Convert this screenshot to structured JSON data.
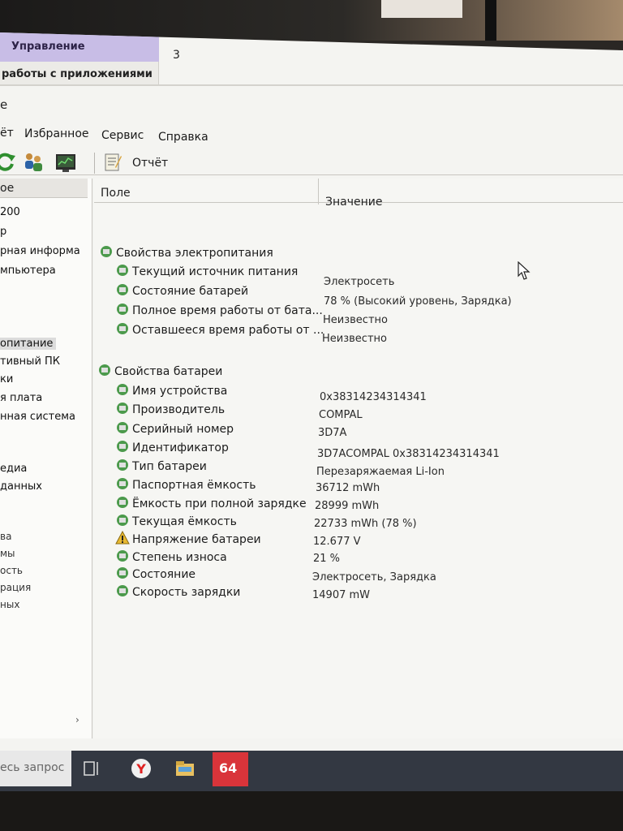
{
  "ribbon": {
    "tab_label": "Управление",
    "number": "3",
    "subtitle": "работы с приложениями"
  },
  "window": {
    "title_fragment": "е"
  },
  "menu": {
    "items": [
      "ёт",
      "Избранное",
      "Сервис",
      "Справка"
    ]
  },
  "toolbar": {
    "report_label": "Отчёт",
    "icons": [
      "refresh-icon",
      "users-icon",
      "monitor-icon",
      "report-icon"
    ]
  },
  "tree": {
    "header": "ое",
    "items": [
      {
        "label": "200"
      },
      {
        "label": "р"
      },
      {
        "label": "рная информа"
      },
      {
        "label": "мпьютера"
      },
      {
        "label": "опитание"
      },
      {
        "label": "тивный ПК"
      },
      {
        "label": "ки"
      },
      {
        "label": "я плата"
      },
      {
        "label": "нная система"
      },
      {
        "label": "едиа"
      },
      {
        "label": "данных"
      },
      {
        "label": "ва"
      },
      {
        "label": "мы"
      },
      {
        "label": "ость"
      },
      {
        "label": "рация"
      },
      {
        "label": "ных"
      }
    ],
    "selected_index": 4
  },
  "table": {
    "col_field": "Поле",
    "col_value": "Значение",
    "groups": [
      {
        "title": "Свойства электропитания",
        "rows": [
          {
            "field": "Текущий источник питания",
            "value": "Электросеть"
          },
          {
            "field": "Состояние батарей",
            "value": "78 % (Высокий уровень, Зарядка)"
          },
          {
            "field": "Полное время работы от бата...",
            "value": "Неизвестно"
          },
          {
            "field": "Оставшееся время работы от ...",
            "value": "Неизвестно"
          }
        ]
      },
      {
        "title": "Свойства батареи",
        "rows": [
          {
            "field": "Имя устройства",
            "value": "0x38314234314341"
          },
          {
            "field": "Производитель",
            "value": "COMPAL"
          },
          {
            "field": "Серийный номер",
            "value": "3D7A"
          },
          {
            "field": "Идентификатор",
            "value": "3D7ACOMPAL 0x38314234314341"
          },
          {
            "field": "Тип батареи",
            "value": "Перезаряжаемая Li-Ion"
          },
          {
            "field": "Паспортная ёмкость",
            "value": "36712 mWh"
          },
          {
            "field": "Ёмкость при полной зарядке",
            "value": "28999 mWh"
          },
          {
            "field": "Текущая ёмкость",
            "value": "22733 mWh  (78 %)"
          },
          {
            "field": "Напряжение батареи",
            "value": "12.677 V",
            "icon": "warning-icon"
          },
          {
            "field": "Степень износа",
            "value": "21 %"
          },
          {
            "field": "Состояние",
            "value": "Электросеть, Зарядка"
          },
          {
            "field": "Скорость зарядки",
            "value": "14907 mW"
          }
        ]
      }
    ]
  },
  "taskbar": {
    "search_placeholder": "есь запрос",
    "aida_label": "64",
    "icons": [
      "task-view-icon",
      "yandex-browser-icon",
      "file-explorer-icon",
      "aida64-icon"
    ]
  },
  "colors": {
    "ribbon_tab": "#c8bde6",
    "aida_red": "#d9343a",
    "taskbar": "#333842"
  }
}
